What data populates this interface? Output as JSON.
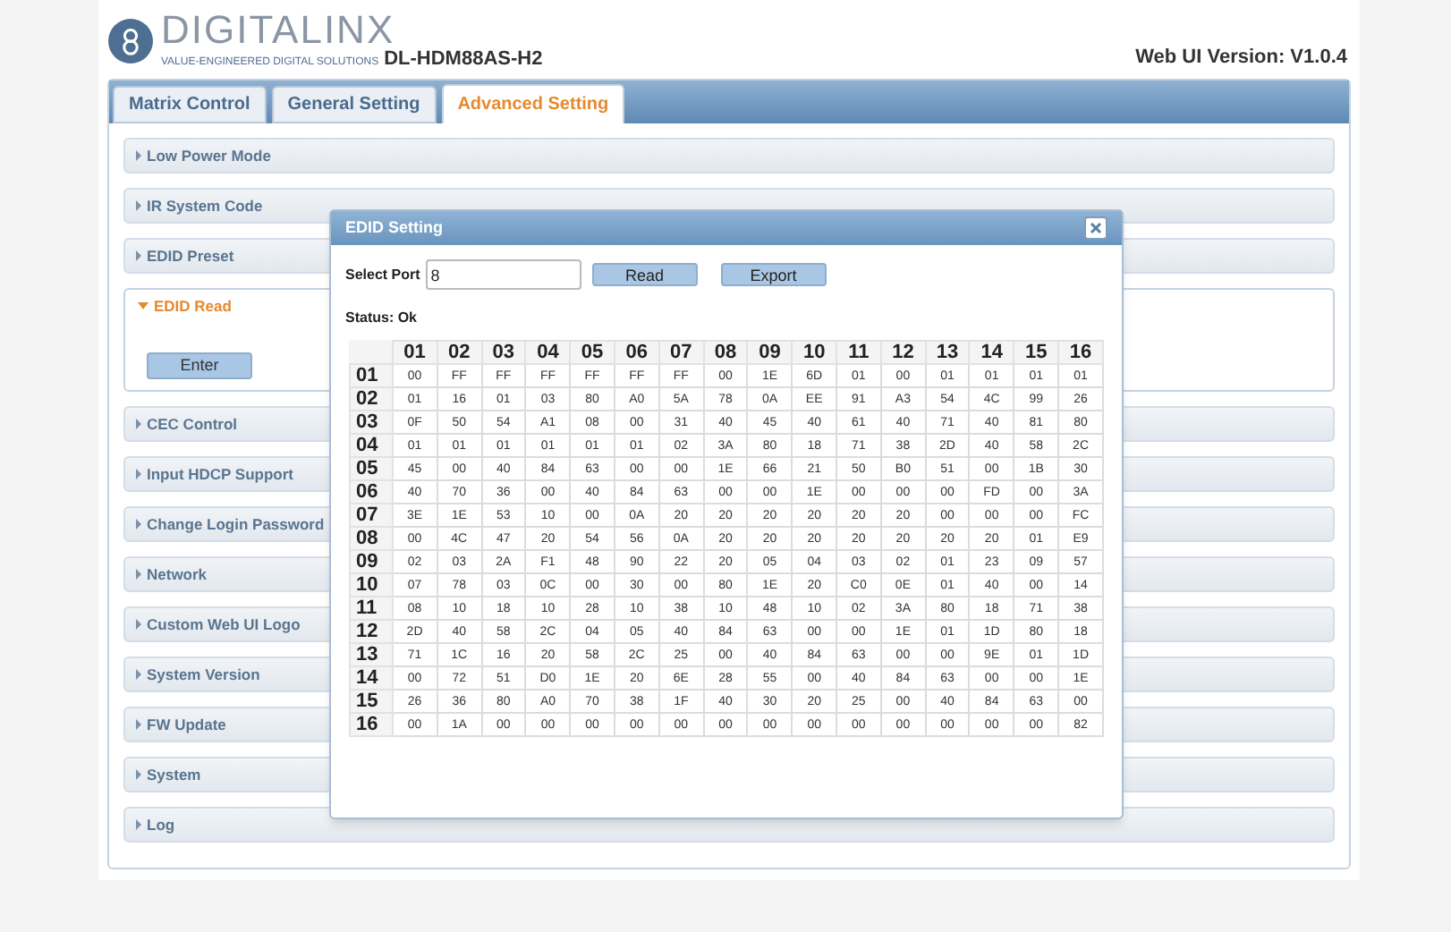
{
  "header": {
    "brand": "DIGITALINX",
    "tagline": "VALUE-ENGINEERED DIGITAL SOLUTIONS",
    "model": "DL-HDM88AS-H2",
    "version": "Web UI Version: V1.0.4"
  },
  "tabs": [
    {
      "label": "Matrix Control",
      "selected": false
    },
    {
      "label": "General Setting",
      "selected": false
    },
    {
      "label": "Advanced Setting",
      "selected": true
    }
  ],
  "sections": [
    {
      "label": "Low Power Mode",
      "expanded": false
    },
    {
      "label": "IR System Code",
      "expanded": false
    },
    {
      "label": "EDID Preset",
      "expanded": false
    },
    {
      "label": "EDID Read",
      "expanded": true,
      "button": "Enter"
    },
    {
      "label": "CEC Control",
      "expanded": false
    },
    {
      "label": "Input HDCP Support",
      "expanded": false
    },
    {
      "label": "Change Login Password",
      "expanded": false
    },
    {
      "label": "Network",
      "expanded": false
    },
    {
      "label": "Custom Web UI Logo",
      "expanded": false
    },
    {
      "label": "System Version",
      "expanded": false
    },
    {
      "label": "FW Update",
      "expanded": false
    },
    {
      "label": "System",
      "expanded": false
    },
    {
      "label": "Log",
      "expanded": false
    }
  ],
  "dialog": {
    "title": "EDID Setting",
    "port_label": "Select Port",
    "port_value": "8",
    "read_button": "Read",
    "export_button": "Export",
    "status": "Status: Ok",
    "columns": [
      "01",
      "02",
      "03",
      "04",
      "05",
      "06",
      "07",
      "08",
      "09",
      "10",
      "11",
      "12",
      "13",
      "14",
      "15",
      "16"
    ],
    "rows": [
      {
        "label": "01",
        "cells": [
          "00",
          "FF",
          "FF",
          "FF",
          "FF",
          "FF",
          "FF",
          "00",
          "1E",
          "6D",
          "01",
          "00",
          "01",
          "01",
          "01",
          "01"
        ]
      },
      {
        "label": "02",
        "cells": [
          "01",
          "16",
          "01",
          "03",
          "80",
          "A0",
          "5A",
          "78",
          "0A",
          "EE",
          "91",
          "A3",
          "54",
          "4C",
          "99",
          "26"
        ]
      },
      {
        "label": "03",
        "cells": [
          "0F",
          "50",
          "54",
          "A1",
          "08",
          "00",
          "31",
          "40",
          "45",
          "40",
          "61",
          "40",
          "71",
          "40",
          "81",
          "80"
        ]
      },
      {
        "label": "04",
        "cells": [
          "01",
          "01",
          "01",
          "01",
          "01",
          "01",
          "02",
          "3A",
          "80",
          "18",
          "71",
          "38",
          "2D",
          "40",
          "58",
          "2C"
        ]
      },
      {
        "label": "05",
        "cells": [
          "45",
          "00",
          "40",
          "84",
          "63",
          "00",
          "00",
          "1E",
          "66",
          "21",
          "50",
          "B0",
          "51",
          "00",
          "1B",
          "30"
        ]
      },
      {
        "label": "06",
        "cells": [
          "40",
          "70",
          "36",
          "00",
          "40",
          "84",
          "63",
          "00",
          "00",
          "1E",
          "00",
          "00",
          "00",
          "FD",
          "00",
          "3A"
        ]
      },
      {
        "label": "07",
        "cells": [
          "3E",
          "1E",
          "53",
          "10",
          "00",
          "0A",
          "20",
          "20",
          "20",
          "20",
          "20",
          "20",
          "00",
          "00",
          "00",
          "FC"
        ]
      },
      {
        "label": "08",
        "cells": [
          "00",
          "4C",
          "47",
          "20",
          "54",
          "56",
          "0A",
          "20",
          "20",
          "20",
          "20",
          "20",
          "20",
          "20",
          "01",
          "E9"
        ]
      },
      {
        "label": "09",
        "cells": [
          "02",
          "03",
          "2A",
          "F1",
          "48",
          "90",
          "22",
          "20",
          "05",
          "04",
          "03",
          "02",
          "01",
          "23",
          "09",
          "57"
        ]
      },
      {
        "label": "10",
        "cells": [
          "07",
          "78",
          "03",
          "0C",
          "00",
          "30",
          "00",
          "80",
          "1E",
          "20",
          "C0",
          "0E",
          "01",
          "40",
          "00",
          "14"
        ]
      },
      {
        "label": "11",
        "cells": [
          "08",
          "10",
          "18",
          "10",
          "28",
          "10",
          "38",
          "10",
          "48",
          "10",
          "02",
          "3A",
          "80",
          "18",
          "71",
          "38"
        ]
      },
      {
        "label": "12",
        "cells": [
          "2D",
          "40",
          "58",
          "2C",
          "04",
          "05",
          "40",
          "84",
          "63",
          "00",
          "00",
          "1E",
          "01",
          "1D",
          "80",
          "18"
        ]
      },
      {
        "label": "13",
        "cells": [
          "71",
          "1C",
          "16",
          "20",
          "58",
          "2C",
          "25",
          "00",
          "40",
          "84",
          "63",
          "00",
          "00",
          "9E",
          "01",
          "1D"
        ]
      },
      {
        "label": "14",
        "cells": [
          "00",
          "72",
          "51",
          "D0",
          "1E",
          "20",
          "6E",
          "28",
          "55",
          "00",
          "40",
          "84",
          "63",
          "00",
          "00",
          "1E"
        ]
      },
      {
        "label": "15",
        "cells": [
          "26",
          "36",
          "80",
          "A0",
          "70",
          "38",
          "1F",
          "40",
          "30",
          "20",
          "25",
          "00",
          "40",
          "84",
          "63",
          "00"
        ]
      },
      {
        "label": "16",
        "cells": [
          "00",
          "1A",
          "00",
          "00",
          "00",
          "00",
          "00",
          "00",
          "00",
          "00",
          "00",
          "00",
          "00",
          "00",
          "00",
          "82"
        ]
      }
    ]
  }
}
